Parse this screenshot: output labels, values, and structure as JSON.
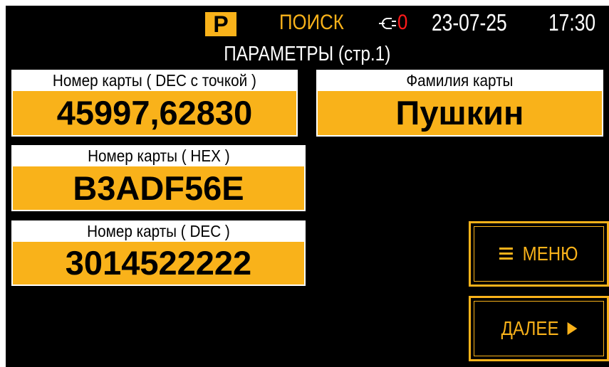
{
  "status_bar": {
    "mode_badge": "P",
    "mode_text": "ПОИСК",
    "usb_icon": "usb-icon",
    "usb_count": "0",
    "date": "23-07-25",
    "time": "17:30"
  },
  "page_title": "ПАРАМЕТРЫ (стр.1)",
  "fields": {
    "dec_dot": {
      "label": "Номер карты ( DEC с точкой )",
      "value": "45997,62830"
    },
    "surname": {
      "label": "Фамилия карты",
      "value": "Пушкин"
    },
    "hex": {
      "label": "Номер карты ( HEX )",
      "value": "B3ADF56E"
    },
    "dec": {
      "label": "Номер карты ( DEC )",
      "value": "3014522222"
    }
  },
  "buttons": {
    "menu": {
      "label": "МЕНЮ",
      "icon": "hamburger-icon"
    },
    "next": {
      "label": "ДАЛЕЕ",
      "icon": "play-arrow-icon"
    }
  },
  "colors": {
    "accent": "#f9b21a",
    "background": "#000000",
    "alert": "#ff1a1a",
    "text": "#ffffff"
  }
}
